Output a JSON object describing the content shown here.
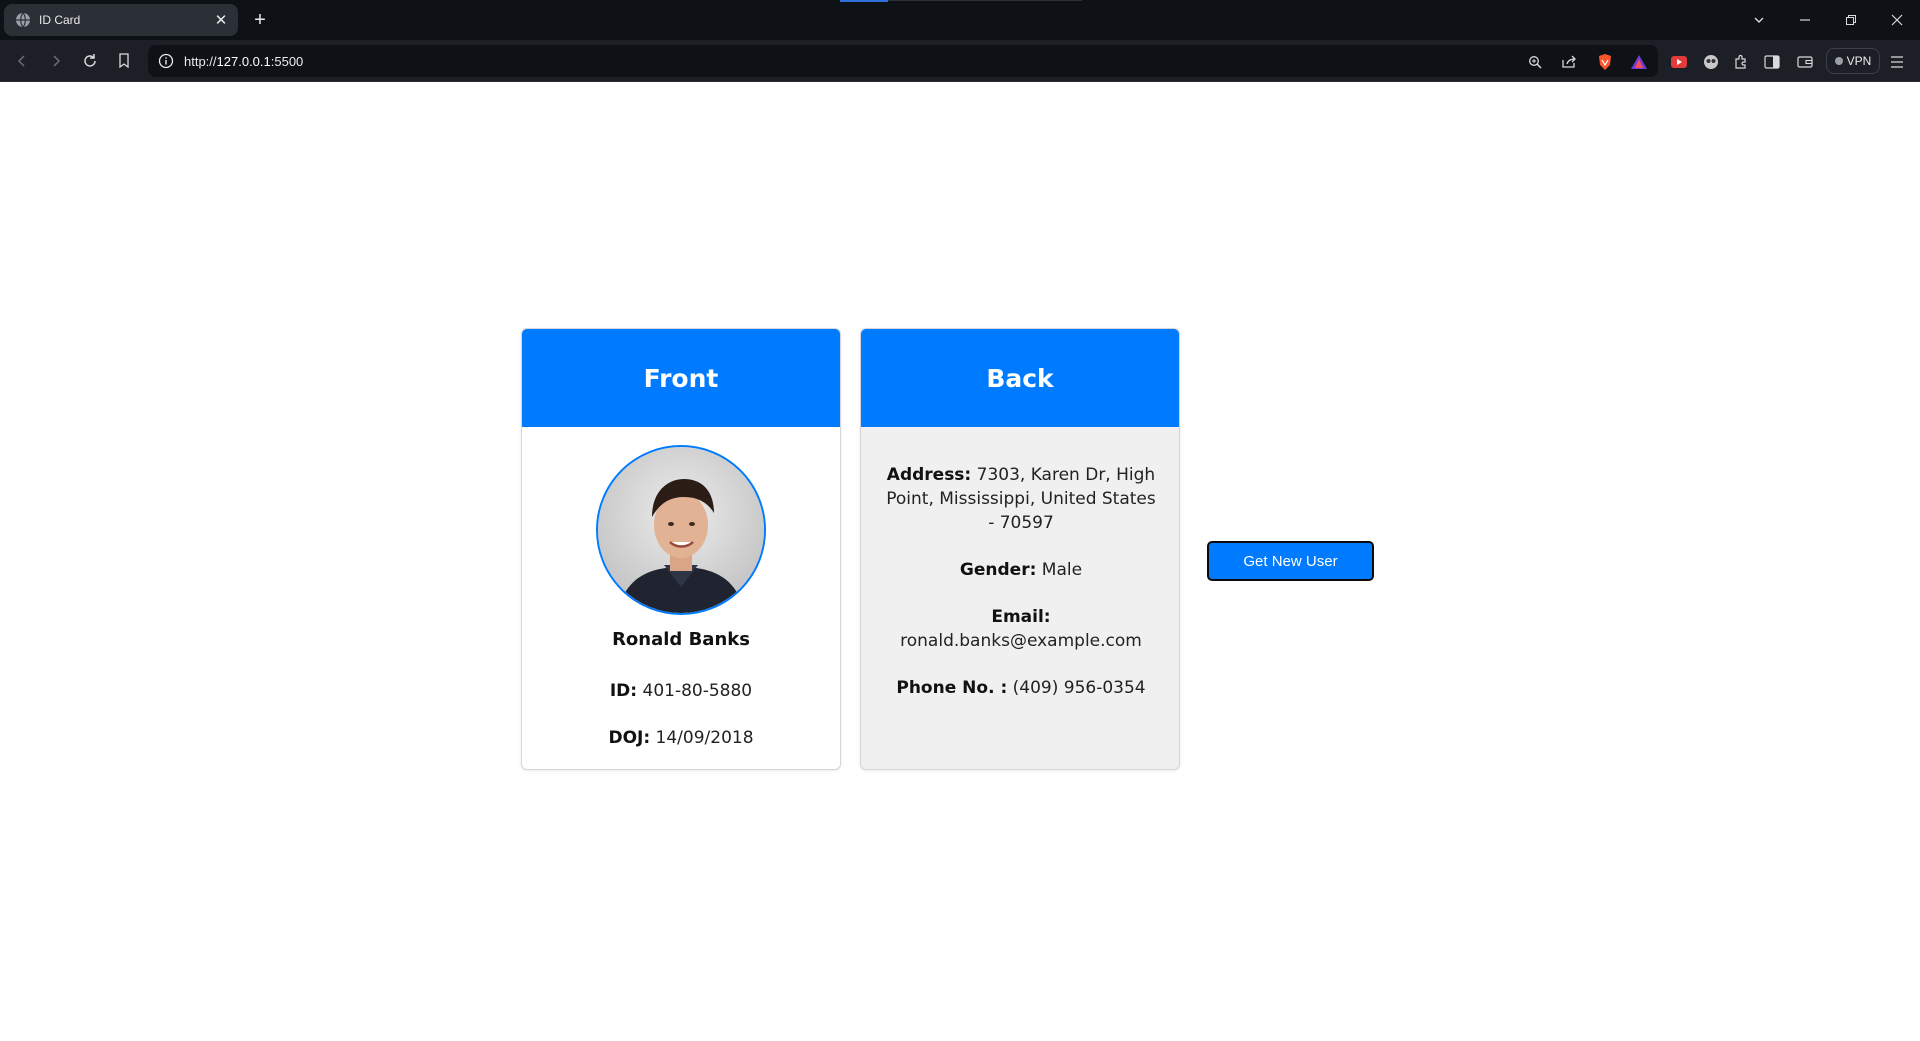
{
  "browser": {
    "tab_title": "ID Card",
    "url_prefix": "http://",
    "url_host": "127.0.0.1",
    "url_port": ":5500",
    "vpn_label": "VPN"
  },
  "front": {
    "header": "Front",
    "name": "Ronald Banks",
    "id_label": "ID:",
    "id_value": "401-80-5880",
    "doj_label": "DOJ:",
    "doj_value": "14/09/2018"
  },
  "back": {
    "header": "Back",
    "address_label": "Address:",
    "address_value": "7303, Karen Dr, High Point, Mississippi, United States - 70597",
    "gender_label": "Gender:",
    "gender_value": "Male",
    "email_label": "Email:",
    "email_value": "ronald.banks@example.com",
    "phone_label": "Phone No. :",
    "phone_value": "(409) 956-0354"
  },
  "actions": {
    "get_new_user": "Get New User"
  },
  "colors": {
    "accent": "#007bff",
    "back_card_bg": "#f0f0f0"
  }
}
